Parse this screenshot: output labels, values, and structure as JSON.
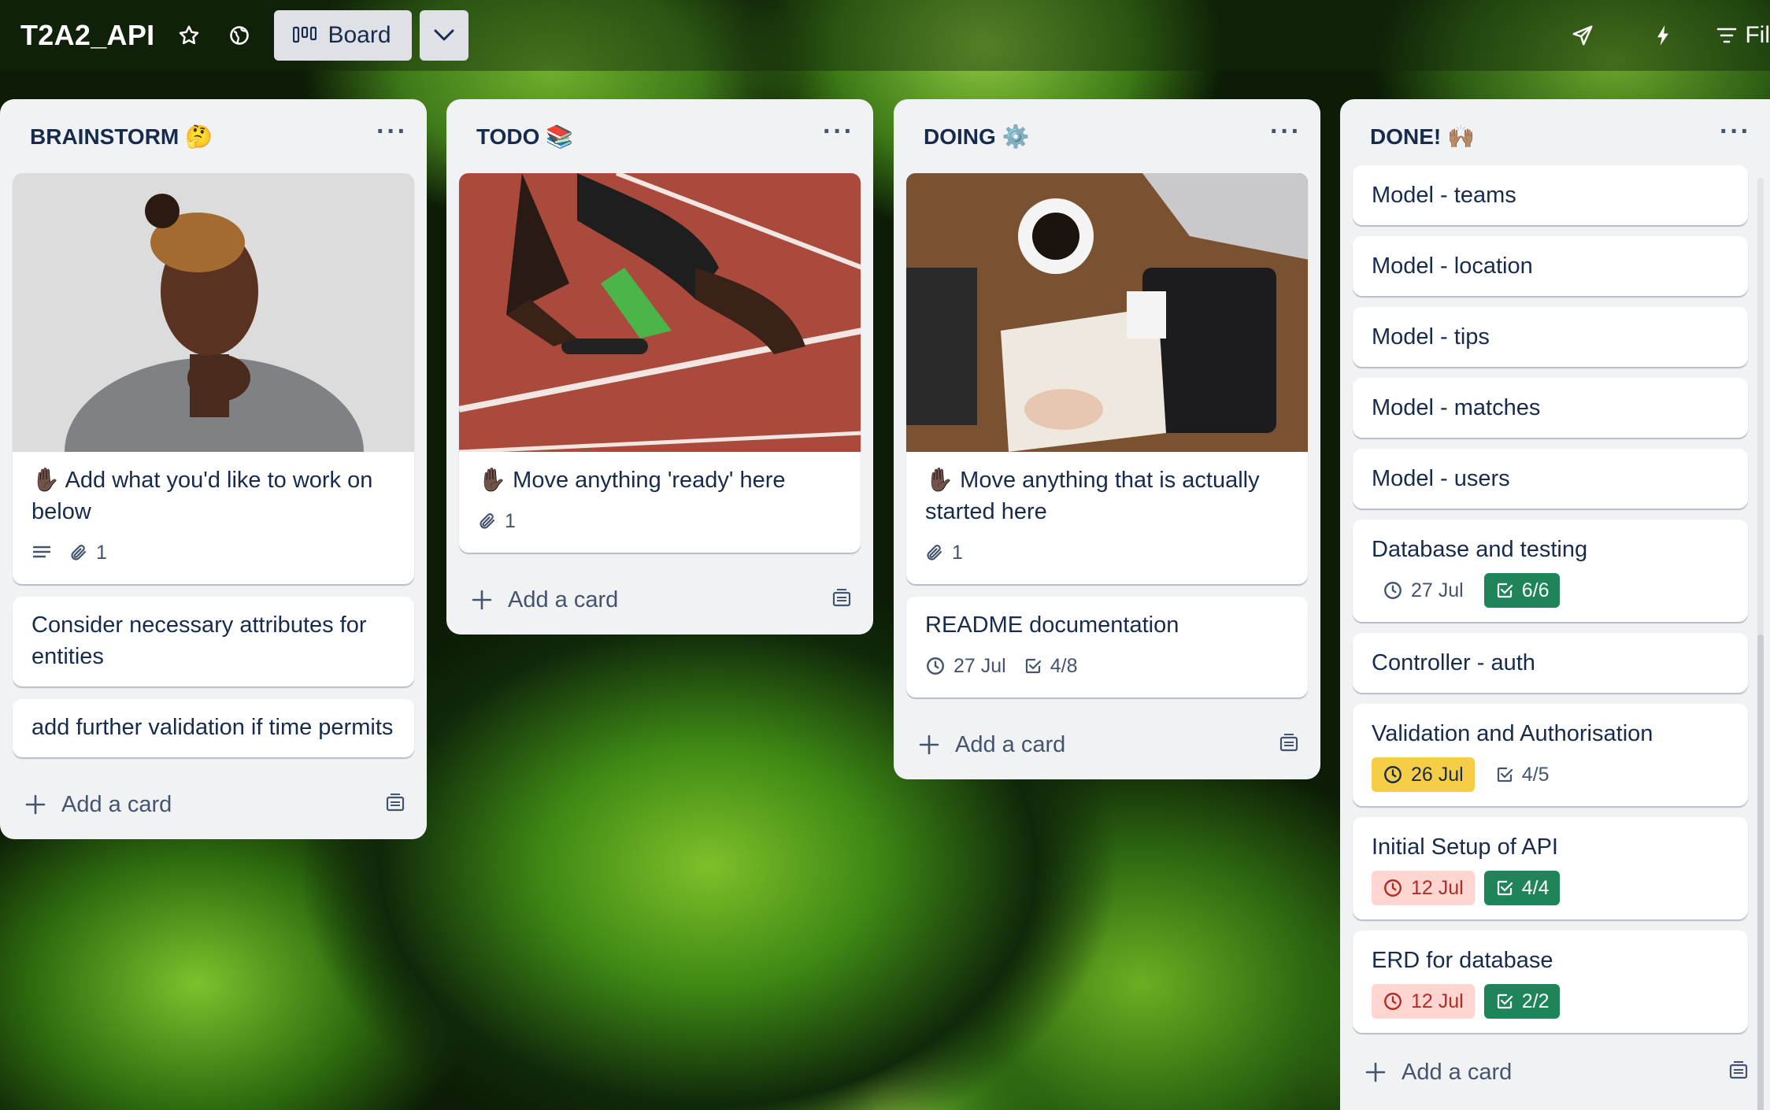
{
  "header": {
    "board_title": "T2A2_API",
    "view_label": "Board",
    "filter_label": "Fil"
  },
  "lists": [
    {
      "title": "BRAINSTORM 🤔",
      "add_card_label": "Add a card",
      "cards": [
        {
          "title": "✋🏿 Add what you'd like to work on below",
          "attachments": "1"
        },
        {
          "title": "Consider necessary attributes for entities"
        },
        {
          "title": "add further validation if time permits"
        }
      ]
    },
    {
      "title": "TODO 📚",
      "add_card_label": "Add a card",
      "cards": [
        {
          "title": "✋🏿 Move anything 'ready' here",
          "attachments": "1"
        }
      ]
    },
    {
      "title": "DOING ⚙️",
      "add_card_label": "Add a card",
      "cards": [
        {
          "title": "✋🏿 Move anything that is actually started here",
          "attachments": "1"
        },
        {
          "title": "README documentation",
          "due": "27 Jul",
          "checklist": "4/8"
        }
      ]
    },
    {
      "title": "DONE! 🙌🏽",
      "add_card_label": "Add a card",
      "cards": [
        {
          "title": "Model - teams"
        },
        {
          "title": "Model - location"
        },
        {
          "title": "Model - tips"
        },
        {
          "title": "Model - matches"
        },
        {
          "title": "Model - users"
        },
        {
          "title": "Database and testing",
          "due": "27 Jul",
          "checklist": "6/6"
        },
        {
          "title": "Controller - auth"
        },
        {
          "title": "Validation and Authorisation",
          "due": "26 Jul",
          "checklist": "4/5"
        },
        {
          "title": "Initial Setup of API",
          "due": "12 Jul",
          "checklist": "4/4"
        },
        {
          "title": "ERD for database",
          "due": "12 Jul",
          "checklist": "2/2"
        }
      ]
    }
  ],
  "colors": {
    "done_green": "#1f845a",
    "due_soon_yellow": "#f5cd47",
    "overdue_red": "#ffd5d2",
    "list_bg": "#f1f2f4"
  },
  "icons": [
    "star-icon",
    "globe-icon",
    "board-view-icon",
    "chevron-down-icon",
    "share-icon",
    "lightning-icon",
    "filter-icon",
    "more-icon",
    "description-icon",
    "paperclip-icon",
    "clock-icon",
    "checklist-icon",
    "plus-icon",
    "template-icon"
  ]
}
